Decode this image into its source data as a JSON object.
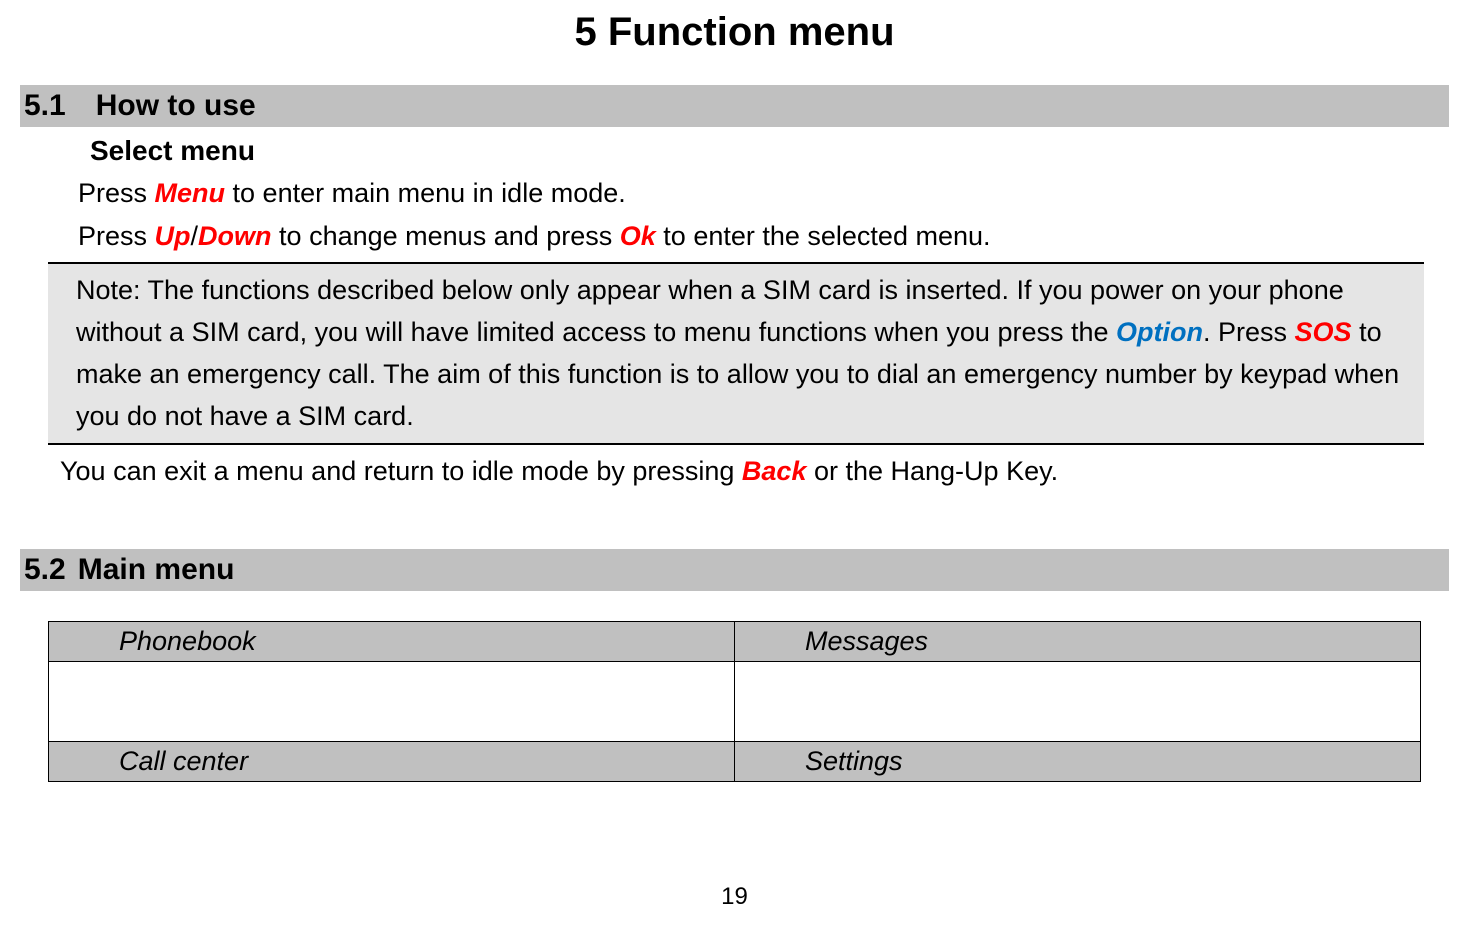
{
  "chapter": {
    "title": "5 Function menu"
  },
  "sections": {
    "s1": {
      "num": "5.1",
      "title": "How to use",
      "subsection": "Select menu",
      "p1_a": "Press ",
      "p1_key": "Menu",
      "p1_b": " to enter main menu in idle mode.",
      "p2_a": "Press ",
      "p2_key1": "Up",
      "p2_slash": "/",
      "p2_key2": "Down",
      "p2_b": " to change menus and press ",
      "p2_key3": "Ok",
      "p2_c": " to enter the selected menu.",
      "note_a": "Note: The functions described below only appear when a SIM card is inserted. If you power on your phone without a SIM card, you will have limited access to menu functions when you press the ",
      "note_key1": "Option",
      "note_b": ". Press ",
      "note_key2": "SOS",
      "note_c": " to make an emergency call. The aim of this function is to allow you to dial an emergency number by keypad when you do not have a SIM card.",
      "p3_a": "You can exit a menu and return to idle mode by pressing ",
      "p3_key": "Back",
      "p3_b": " or the Hang-Up Key."
    },
    "s2": {
      "num": "5.2",
      "title": "Main menu"
    }
  },
  "menu_table": {
    "row1": {
      "left": "Phonebook",
      "right": "Messages"
    },
    "row2": {
      "left": "",
      "right": ""
    },
    "row3": {
      "left": "Call center",
      "right": "Settings"
    }
  },
  "page_number": "19"
}
